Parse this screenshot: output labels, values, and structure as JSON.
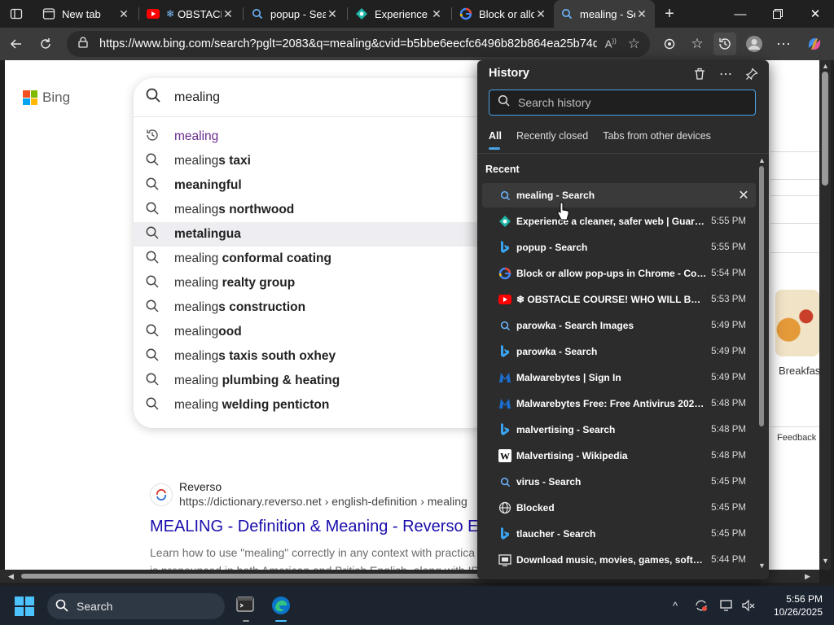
{
  "browser": {
    "tabs": [
      {
        "title": "New tab",
        "icon": "new-tab-icon",
        "active": false
      },
      {
        "title": "OBSTACL",
        "icon": "youtube-icon",
        "active": false
      },
      {
        "title": "popup - Sea",
        "icon": "bing-search-icon",
        "active": false
      },
      {
        "title": "Experience a",
        "icon": "guardio-icon",
        "active": false
      },
      {
        "title": "Block or allo",
        "icon": "google-icon",
        "active": false
      },
      {
        "title": "mealing - Se",
        "icon": "bing-search-icon",
        "active": true
      }
    ],
    "address_url": "https://www.bing.com/search?pglt=2083&q=mealing&cvid=b5bbe6eecfc6496b82b864ea25b74d..."
  },
  "page": {
    "brand": "Bing",
    "search_query": "mealing",
    "suggestions": [
      {
        "prefix": "mealing",
        "bold": "",
        "history": true
      },
      {
        "prefix": "mealing",
        "bold": "s taxi",
        "history": false
      },
      {
        "prefix": "",
        "bold": "meaningful",
        "history": false
      },
      {
        "prefix": "mealing",
        "bold": "s northwood",
        "history": false
      },
      {
        "prefix": "",
        "bold": "metalingua",
        "history": false,
        "highlighted": true
      },
      {
        "prefix": "mealing ",
        "bold": "conformal coating",
        "history": false
      },
      {
        "prefix": "mealing ",
        "bold": "realty group",
        "history": false
      },
      {
        "prefix": "mealing",
        "bold": "s construction",
        "history": false
      },
      {
        "prefix": "mealing",
        "bold": "ood",
        "history": false
      },
      {
        "prefix": "mealing",
        "bold": "s taxis south oxhey",
        "history": false
      },
      {
        "prefix": "mealing ",
        "bold": "plumbing & heating",
        "history": false
      },
      {
        "prefix": "mealing ",
        "bold": "welding penticton",
        "history": false
      }
    ],
    "right_card_label": "Breakfas",
    "feedback_label": "Feedback",
    "result": {
      "site": "Reverso",
      "url": "https://dictionary.reverso.net › english-definition › mealing",
      "title": "MEALING - Definition & Meaning - Reverso En",
      "snippet_line1": "Learn how to use \"mealing\" correctly in any context with practica",
      "snippet_line2": "is pronounced in both American and British English, along with IP"
    }
  },
  "history_panel": {
    "title": "History",
    "search_placeholder": "Search history",
    "tabs": [
      "All",
      "Recently closed",
      "Tabs from other devices"
    ],
    "section": "Recent",
    "items": [
      {
        "title": "mealing - Search",
        "time": "",
        "icon": "bing-search-icon"
      },
      {
        "title": "Experience a cleaner, safer web | Guardio",
        "time": "5:55 PM",
        "icon": "guardio-icon"
      },
      {
        "title": "popup - Search",
        "time": "5:55 PM",
        "icon": "bing-icon"
      },
      {
        "title": "Block or allow pop-ups in Chrome - Comp...",
        "time": "5:54 PM",
        "icon": "google-icon"
      },
      {
        "title": "❄ OBSTACLE COURSE! WHO WILL BE TH...",
        "time": "5:53 PM",
        "icon": "youtube-icon"
      },
      {
        "title": "parowka - Search Images",
        "time": "5:49 PM",
        "icon": "bing-search-icon"
      },
      {
        "title": "parowka - Search",
        "time": "5:49 PM",
        "icon": "bing-icon"
      },
      {
        "title": "Malwarebytes | Sign In",
        "time": "5:49 PM",
        "icon": "malwarebytes-icon"
      },
      {
        "title": "Malwarebytes Free: Free Antivirus 2025 | 1...",
        "time": "5:48 PM",
        "icon": "malwarebytes-icon"
      },
      {
        "title": "malvertising - Search",
        "time": "5:48 PM",
        "icon": "bing-icon"
      },
      {
        "title": "Malvertising - Wikipedia",
        "time": "5:48 PM",
        "icon": "wikipedia-icon"
      },
      {
        "title": "virus - Search",
        "time": "5:45 PM",
        "icon": "bing-search-icon"
      },
      {
        "title": "Blocked",
        "time": "5:45 PM",
        "icon": "globe-icon"
      },
      {
        "title": "tlaucher - Search",
        "time": "5:45 PM",
        "icon": "bing-icon"
      },
      {
        "title": "Download music, movies, games, software...",
        "time": "5:44 PM",
        "icon": "download-site-icon"
      }
    ]
  },
  "taskbar": {
    "search_label": "Search",
    "time": "5:56 PM",
    "date": "10/26/2025"
  },
  "colors": {
    "accent": "#4aa3e8",
    "link": "#1a0dab",
    "visited_suggestion": "#6a2c8e"
  }
}
